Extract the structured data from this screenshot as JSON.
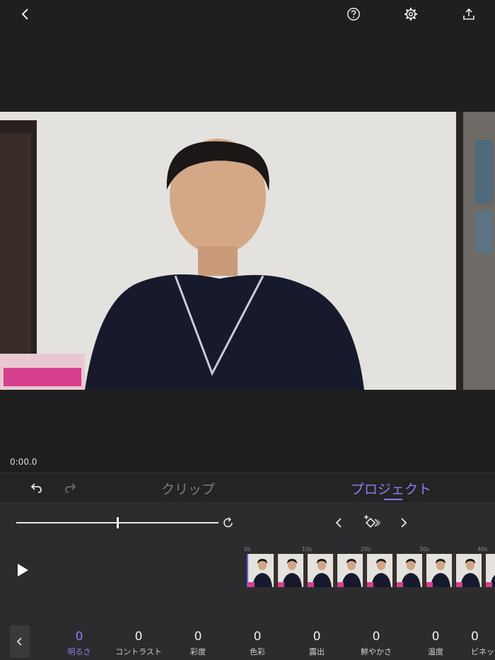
{
  "player": {
    "timecode": "0:00.0"
  },
  "tabs": {
    "clip": "クリップ",
    "project": "プロジェクト"
  },
  "adjust": {
    "slider_level": 0.5
  },
  "timeline": {
    "ruler_labels": [
      "0s",
      "10s",
      "20s",
      "30s",
      "40s"
    ]
  },
  "params": [
    {
      "value": "0",
      "label": "明るさ"
    },
    {
      "value": "0",
      "label": "コントラスト"
    },
    {
      "value": "0",
      "label": "彩度"
    },
    {
      "value": "0",
      "label": "色彩"
    },
    {
      "value": "0",
      "label": "露出"
    },
    {
      "value": "0",
      "label": "鮮やかさ"
    },
    {
      "value": "0",
      "label": "温度"
    },
    {
      "value": "0",
      "label": "ビネット"
    }
  ],
  "colors": {
    "accent": "#8b7cf6",
    "panel": "#2c2c2e",
    "background": "#1f1f1f"
  },
  "icons": [
    "back-chevron-icon",
    "help-icon",
    "gear-icon",
    "share-icon",
    "undo-icon",
    "redo-icon",
    "reset-icon",
    "keyframe-prev-icon",
    "keyframe-add-icon",
    "keyframe-next-icon",
    "play-icon"
  ]
}
